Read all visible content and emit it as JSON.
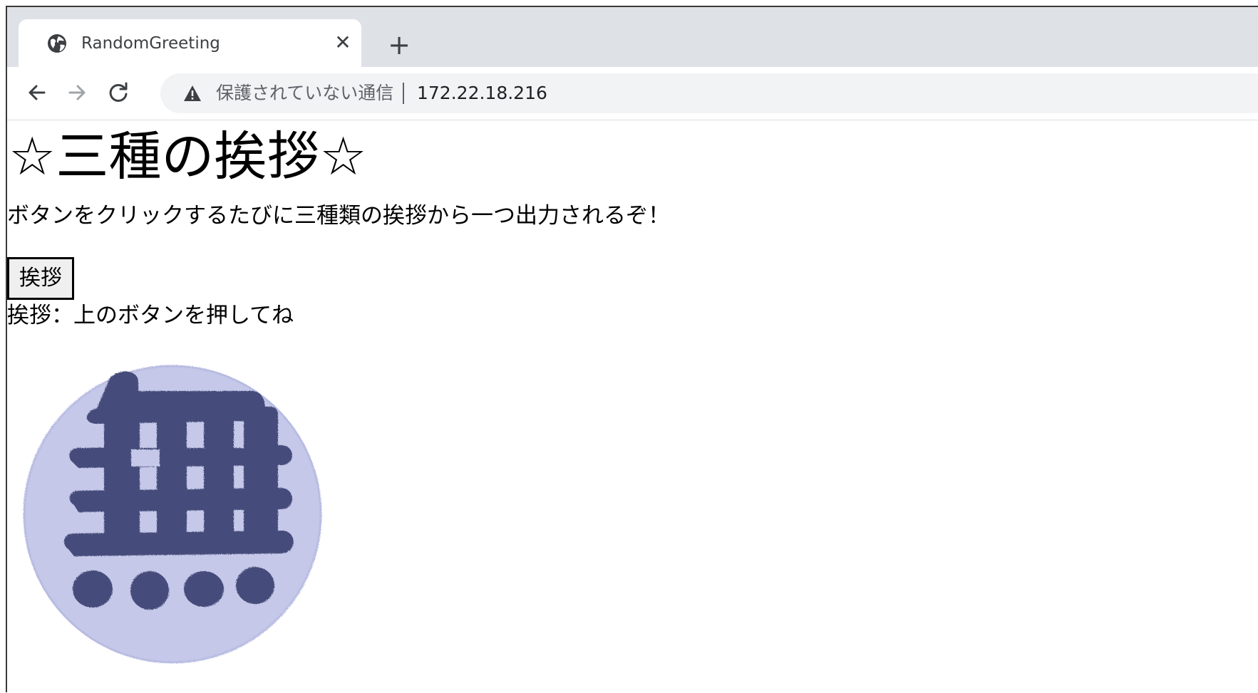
{
  "browser": {
    "tab": {
      "title": "RandomGreeting",
      "close_glyph": "✕",
      "favicon": "globe-icon"
    },
    "new_tab_glyph": "+",
    "nav": {
      "back": "arrow-left-icon",
      "forward": "arrow-right-icon",
      "reload": "reload-icon"
    },
    "address_bar": {
      "security_label": "保護されていない通信",
      "url": "172.22.18.216",
      "security_icon": "warning-icon"
    }
  },
  "page": {
    "heading": "☆三種の挨拶☆",
    "description": "ボタンをクリックするたびに三種類の挨拶から一つ出力されるぞ！",
    "button_label": "挨拶",
    "output_label": "挨拶：",
    "output_text": "上のボタンを押してね",
    "image": {
      "character": "無",
      "icon": "mu-kanji-stamp-icon",
      "circle_color": "#c5c8e8",
      "ink_color": "#454c7a"
    }
  },
  "colors": {
    "tabstrip": "#dee1e6",
    "omnibox": "#f1f3f4",
    "text_dark": "#202124",
    "text_muted": "#5f6368"
  }
}
